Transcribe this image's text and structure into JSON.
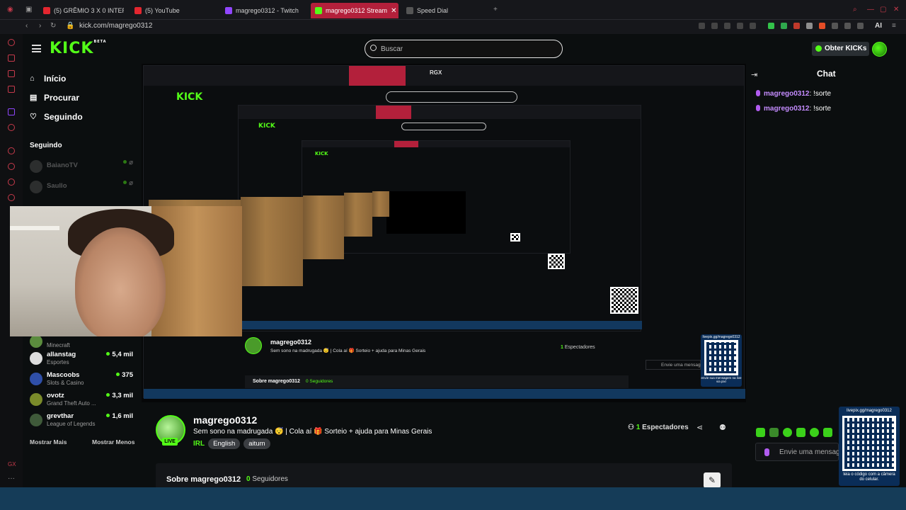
{
  "browser": {
    "tabs": [
      {
        "label": "(5) GRÊMIO 3 X 0 INTERNAC",
        "color": "#e3262f"
      },
      {
        "label": "(5) YouTube",
        "color": "#e3262f"
      },
      {
        "label": "magrego0312 - Twitch",
        "color": "#9146ff"
      },
      {
        "label": "magrego0312 Stream",
        "color": "#53fc18"
      },
      {
        "label": "Speed Dial",
        "color": "#888888"
      }
    ],
    "url": "kick.com/magrego0312",
    "ai_label": "AI"
  },
  "header": {
    "logo": "KICK",
    "logo_badge": "BETA",
    "search_placeholder": "Buscar",
    "kicks_button": "Obter KICKs"
  },
  "nav": {
    "items": [
      {
        "label": "Início",
        "icon": "home-icon"
      },
      {
        "label": "Procurar",
        "icon": "browse-icon"
      },
      {
        "label": "Seguindo",
        "icon": "heart-icon"
      }
    ],
    "section_title": "Seguindo"
  },
  "following": {
    "offline": [
      {
        "name": "BaianoTV"
      },
      {
        "name": "Saullo"
      }
    ],
    "online": [
      {
        "name": "",
        "category": "Minecraft",
        "viewers": ""
      },
      {
        "name": "allanstag",
        "category": "Esportes",
        "viewers": "5,4 mil"
      },
      {
        "name": "Mascoobs",
        "category": "Slots & Casino",
        "viewers": "375"
      },
      {
        "name": "ovotz",
        "category": "Grand Theft Auto ...",
        "viewers": "3,3 mil"
      },
      {
        "name": "grevthar",
        "category": "League of Legends",
        "viewers": "1,6 mil"
      }
    ],
    "show_more": "Mostrar Mais",
    "show_less": "Mostrar Menos"
  },
  "video_overlay": {
    "rgx_label": "RGX",
    "nested_sobre": "Sobre magrego0312",
    "nested_followers": "0 Seguidores",
    "nested_qr_caption_top": "livepix.gg/magrego0312",
    "nested_qr_caption_bottom": "envie sua mensagem na live via pix!",
    "nested_chat_placeholder": "Envie uma mensag"
  },
  "stream": {
    "channel": "magrego0312",
    "live_label": "LIVE",
    "title": "Sem sono na madrugada 😴 | Cola aí 🎁 Sorteio + ajuda para Minas Gerais",
    "category": "IRL",
    "tags": [
      "English",
      "aitum"
    ],
    "viewers_count": "1",
    "viewers_label": "Espectadores",
    "about": "Sobre magrego0312",
    "followers_count": "0",
    "followers_label": "Seguidores"
  },
  "chat": {
    "title": "Chat",
    "messages": [
      {
        "user": "magrego0312",
        "text": "!sorte"
      },
      {
        "user": "magrego0312",
        "text": "!sorte"
      }
    ],
    "input_placeholder": "Envie uma mensagem",
    "qr_caption_top": "livepix.gg/magrego0312",
    "qr_caption_bottom": "leia o código com a câmera do celular."
  },
  "colors": {
    "accent": "#53fc18",
    "background": "#0b0e0f",
    "chat_user": "#c58cff",
    "tab_active": "#b3203b"
  }
}
